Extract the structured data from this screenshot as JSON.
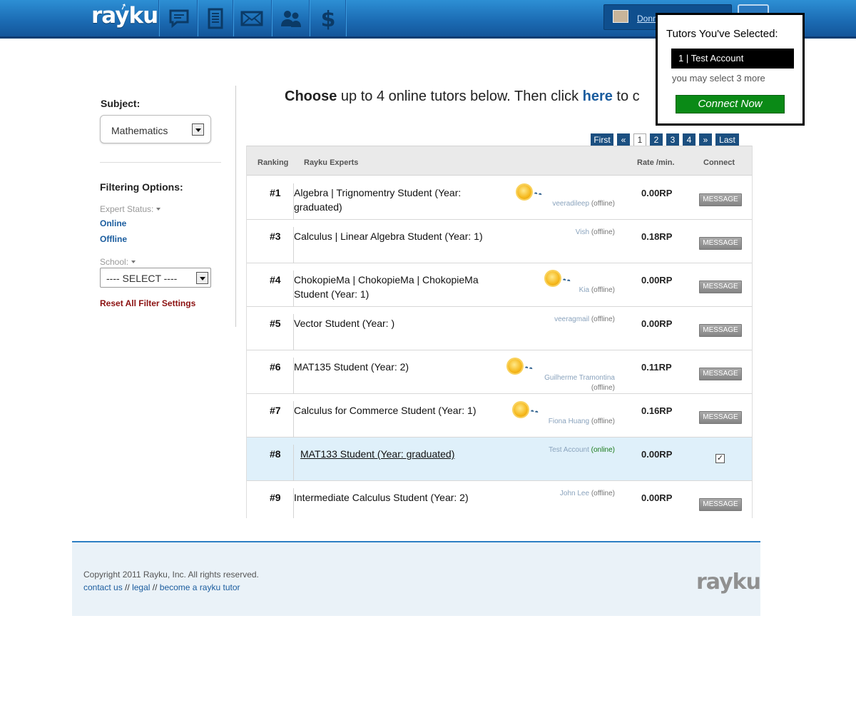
{
  "brand": {
    "logo": "rayku",
    "footer_logo": "rayku"
  },
  "colors": {
    "nav_blue": "#1c6db5",
    "link_blue": "#1a5c9e",
    "connect_green": "#0a8a16",
    "reset_red": "#8b1010",
    "selected_row": "#dff0fa"
  },
  "nav": {
    "icons": [
      "chat-bubble-icon",
      "document-icon",
      "mail-icon",
      "people-icon",
      "dollar-icon"
    ]
  },
  "user": {
    "name": "Donn"
  },
  "popup": {
    "title": "Tutors You've Selected:",
    "selected": "1 | Test Account",
    "remaining": "you may select 3 more",
    "connect_label": "Connect Now"
  },
  "filters": {
    "subject_label": "Subject:",
    "subject_value": "Mathematics",
    "filtering_label": "Filtering Options:",
    "expert_status_label": "Expert Status:",
    "online_label": "Online",
    "offline_label": "Offline",
    "school_label": "School:",
    "school_value": "---- SELECT ----",
    "reset_label": "Reset All Filter Settings"
  },
  "heading": {
    "bold": "Choose",
    "text": " up to 4 online tutors below. Then click ",
    "here": "here",
    "tail": " to c"
  },
  "pagination": [
    "First",
    "«",
    "1",
    "2",
    "3",
    "4",
    "»",
    "Last"
  ],
  "table": {
    "headers": {
      "ranking": "Ranking",
      "experts": "Rayku Experts",
      "rate": "Rate /min.",
      "connect": "Connect"
    },
    "message_label": "MESSAGE",
    "rows": [
      {
        "rank": "#1",
        "title": "Algebra | Trignomentry Student (Year: graduated)",
        "tutor": "veeradileep",
        "status": "(offline)",
        "rate": "0.00RP",
        "badge": true
      },
      {
        "rank": "#3",
        "title": "Calculus | Linear Algebra Student (Year: 1)",
        "tutor": "Vish",
        "status": "(offline)",
        "rate": "0.18RP",
        "badge": false
      },
      {
        "rank": "#4",
        "title": "ChokopieMa | ChokopieMa | ChokopieMa Student (Year: 1)",
        "tutor": "Kia",
        "status": "(offline)",
        "rate": "0.00RP",
        "badge": true
      },
      {
        "rank": "#5",
        "title": "Vector Student (Year: )",
        "tutor": "veeragmail",
        "status": "(offline)",
        "rate": "0.00RP",
        "badge": false
      },
      {
        "rank": "#6",
        "title": "MAT135 Student (Year: 2)",
        "tutor": "Guilherme Tramontina",
        "status": "(offline)",
        "rate": "0.11RP",
        "badge": true
      },
      {
        "rank": "#7",
        "title": "Calculus for Commerce Student (Year: 1)",
        "tutor": "Fiona Huang",
        "status": "(offline)",
        "rate": "0.16RP",
        "badge": true
      },
      {
        "rank": "#8",
        "title": "MAT133 Student (Year: graduated)",
        "tutor": "Test Account",
        "status": "(online)",
        "rate": "0.00RP",
        "badge": false,
        "selected": true,
        "checked": "✓"
      },
      {
        "rank": "#9",
        "title": "Intermediate Calculus Student (Year: 2)",
        "tutor": "John Lee",
        "status": "(offline)",
        "rate": "0.00RP",
        "badge": false
      }
    ]
  },
  "footer": {
    "copyright": "Copyright 2011 Rayku, Inc. All rights reserved.",
    "links": [
      "contact us",
      "legal",
      "become a rayku tutor"
    ],
    "separator": "//"
  }
}
